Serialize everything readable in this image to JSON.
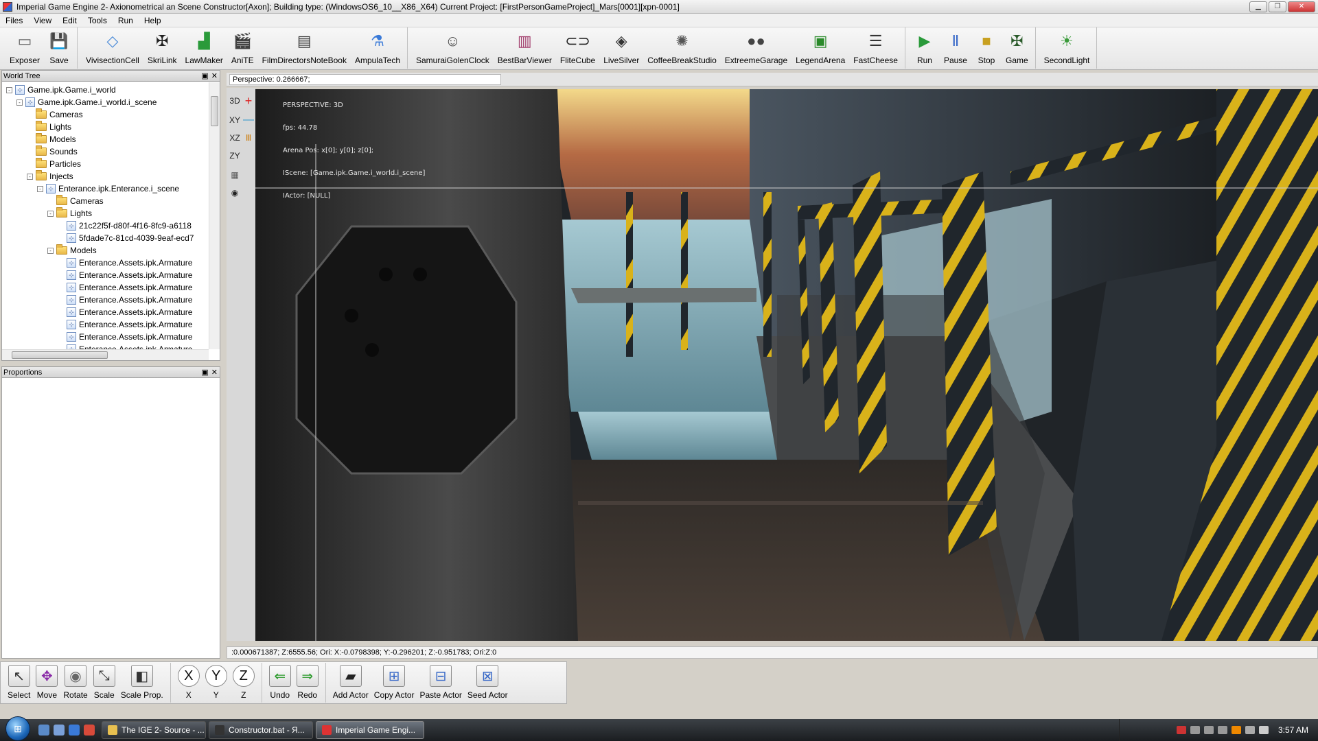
{
  "window": {
    "title": "Imperial Game Engine 2- Axionometrical an Scene Constructor[Axon]; Building type: (WindowsOS6_10__X86_X64) Current Project: [FirstPersonGameProject]_Mars[0001][xpn-0001]"
  },
  "menu": [
    "Files",
    "View",
    "Edit",
    "Tools",
    "Run",
    "Help"
  ],
  "toolbar": {
    "groups": [
      [
        {
          "label": "Exposer",
          "icon": "exposer-icon"
        },
        {
          "label": "Save",
          "icon": "save-icon"
        }
      ],
      [
        {
          "label": "VivisectionCell",
          "icon": "cube-icon"
        },
        {
          "label": "SkriLink",
          "icon": "eagle-icon"
        },
        {
          "label": "LawMaker",
          "icon": "chart-icon"
        },
        {
          "label": "AniTE",
          "icon": "clapper-icon"
        },
        {
          "label": "FilmDirectorsNoteBook",
          "icon": "film-icon"
        },
        {
          "label": "AmpulaTech",
          "icon": "ampule-icon"
        }
      ],
      [
        {
          "label": "SamuraiGolenClock",
          "icon": "masks-icon"
        },
        {
          "label": "BestBarViewer",
          "icon": "barrel-icon"
        },
        {
          "label": "FliteCube",
          "icon": "link-icon"
        },
        {
          "label": "LiveSilver",
          "icon": "diamond-icon"
        },
        {
          "label": "CoffeeBreakStudio",
          "icon": "atom-icon"
        },
        {
          "label": "ExtreemeGarage",
          "icon": "dots-icon"
        },
        {
          "label": "LegendArena",
          "icon": "arena-icon"
        },
        {
          "label": "FastCheese",
          "icon": "sliders-icon"
        }
      ],
      [
        {
          "label": "Run",
          "icon": "run-icon"
        },
        {
          "label": "Pause",
          "icon": "pause-icon"
        },
        {
          "label": "Stop",
          "icon": "stop-icon"
        },
        {
          "label": "Game",
          "icon": "game-icon"
        }
      ],
      [
        {
          "label": "SecondLight",
          "icon": "secondlight-icon"
        }
      ]
    ]
  },
  "world_tree": {
    "title": "World Tree",
    "items": [
      {
        "label": "Game.ipk.Game.i_world",
        "level": 0,
        "type": "node",
        "exp": "-"
      },
      {
        "label": "Game.ipk.Game.i_world.i_scene",
        "level": 1,
        "type": "node",
        "exp": "-"
      },
      {
        "label": "Cameras",
        "level": 2,
        "type": "folder",
        "exp": ""
      },
      {
        "label": "Lights",
        "level": 2,
        "type": "folder",
        "exp": ""
      },
      {
        "label": "Models",
        "level": 2,
        "type": "folder",
        "exp": ""
      },
      {
        "label": "Sounds",
        "level": 2,
        "type": "folder",
        "exp": ""
      },
      {
        "label": "Particles",
        "level": 2,
        "type": "folder",
        "exp": ""
      },
      {
        "label": "Injects",
        "level": 2,
        "type": "folder",
        "exp": "-"
      },
      {
        "label": "Enterance.ipk.Enterance.i_scene",
        "level": 3,
        "type": "node",
        "exp": "-"
      },
      {
        "label": "Cameras",
        "level": 4,
        "type": "folder",
        "exp": ""
      },
      {
        "label": "Lights",
        "level": 4,
        "type": "folder",
        "exp": "-"
      },
      {
        "label": "21c22f5f-d80f-4f16-8fc9-a6118",
        "level": 5,
        "type": "node",
        "exp": ""
      },
      {
        "label": "5fdade7c-81cd-4039-9eaf-ecd7",
        "level": 5,
        "type": "node",
        "exp": ""
      },
      {
        "label": "Models",
        "level": 4,
        "type": "folder",
        "exp": "-"
      },
      {
        "label": "Enterance.Assets.ipk.Armature",
        "level": 5,
        "type": "node",
        "exp": ""
      },
      {
        "label": "Enterance.Assets.ipk.Armature",
        "level": 5,
        "type": "node",
        "exp": ""
      },
      {
        "label": "Enterance.Assets.ipk.Armature",
        "level": 5,
        "type": "node",
        "exp": ""
      },
      {
        "label": "Enterance.Assets.ipk.Armature",
        "level": 5,
        "type": "node",
        "exp": ""
      },
      {
        "label": "Enterance.Assets.ipk.Armature",
        "level": 5,
        "type": "node",
        "exp": ""
      },
      {
        "label": "Enterance.Assets.ipk.Armature",
        "level": 5,
        "type": "node",
        "exp": ""
      },
      {
        "label": "Enterance.Assets.ipk.Armature",
        "level": 5,
        "type": "node",
        "exp": ""
      },
      {
        "label": "Enterance.Assets.ipk.Armature",
        "level": 5,
        "type": "node",
        "exp": ""
      }
    ]
  },
  "proportions": {
    "title": "Proportions"
  },
  "viewport": {
    "perspective_field": "Perspective: 0.266667;",
    "modes": [
      "3D",
      "XY",
      "XZ",
      "ZY"
    ],
    "overlay": [
      "PERSPECTIVE: 3D",
      "fps: 44.78",
      "Arena Pos: x[0]; y[0]; z[0];",
      "IScene: [Game.ipk.Game.i_world.i_scene]",
      "IActor: [NULL]"
    ],
    "status": ":0.000671387; Z:6555.56; Ori: X:-0.0798398; Y:-0.296201; Z:-0.951783; Ori:Z:0"
  },
  "bottom_toolbar": {
    "groups": [
      [
        {
          "label": "Select",
          "icon": "cursor-icon"
        },
        {
          "label": "Move",
          "icon": "move-icon"
        },
        {
          "label": "Rotate",
          "icon": "rotate-icon"
        },
        {
          "label": "Scale",
          "icon": "scale-icon"
        },
        {
          "label": "Scale Prop.",
          "icon": "scale-prop-icon"
        }
      ],
      [
        {
          "label": "X",
          "icon": "axis-x-icon"
        },
        {
          "label": "Y",
          "icon": "axis-y-icon"
        },
        {
          "label": "Z",
          "icon": "axis-z-icon"
        }
      ],
      [
        {
          "label": "Undo",
          "icon": "undo-icon"
        },
        {
          "label": "Redo",
          "icon": "redo-icon"
        }
      ],
      [
        {
          "label": "Add Actor",
          "icon": "add-actor-icon"
        },
        {
          "label": "Copy Actor",
          "icon": "copy-actor-icon"
        },
        {
          "label": "Paste Actor",
          "icon": "paste-actor-icon"
        },
        {
          "label": "Seed Actor",
          "icon": "seed-actor-icon"
        }
      ]
    ]
  },
  "taskbar": {
    "tasks": [
      {
        "label": "The IGE 2- Source - ...",
        "icon": "folder-task-icon"
      },
      {
        "label": "Constructor.bat - Я...",
        "icon": "console-task-icon"
      },
      {
        "label": "Imperial Game Engi...",
        "icon": "ige-task-icon",
        "active": true
      }
    ],
    "clock": "3:57 AM"
  }
}
